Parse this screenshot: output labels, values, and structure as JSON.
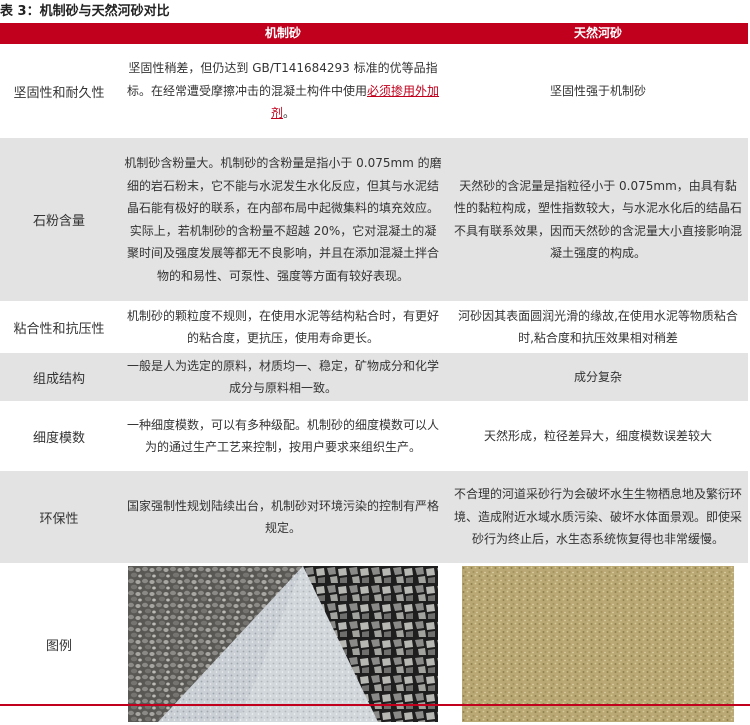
{
  "title": "表 3：机制砂与天然河砂对比",
  "header": {
    "col1": "",
    "col2": "机制砂",
    "col3": "天然河砂"
  },
  "rows": [
    {
      "label": "坚固性和耐久性",
      "manufactured_pre": "坚固性稍差，但仍达到 GB/T141684293 标准的优等品指标。在经常遭受摩擦冲击的混凝土构件中使用",
      "manufactured_highlight": "必须掺用外加剂",
      "manufactured_post": "。",
      "natural": "坚固性强于机制砂"
    },
    {
      "label": "石粉含量",
      "manufactured": "机制砂含粉量大。机制砂的含粉量是指小于 0.075mm 的磨细的岩石粉末，它不能与水泥发生水化反应，但其与水泥结晶石能有极好的联系，在内部布局中起微集料的填充效应。实际上，若机制砂的含粉量不超越 20%，它对混凝土的凝聚时间及强度发展等都无不良影响，并且在添加混凝土拌合物的和易性、可泵性、强度等方面有较好表现。",
      "natural": "天然砂的含泥量是指粒径小于 0.075mm，由具有黏性的黏粒构成，塑性指数较大，与水泥水化后的结晶石不具有联系效果，因而天然砂的含泥量大小直接影响混凝土强度的构成。"
    },
    {
      "label": "粘合性和抗压性",
      "manufactured": "机制砂的颗粒度不规则，在使用水泥等结构粘合时，有更好的粘合度，更抗压，使用寿命更长。",
      "natural": "河砂因其表面圆润光滑的缘故,在使用水泥等物质粘合时,粘合度和抗压效果相对稍差"
    },
    {
      "label": "组成结构",
      "manufactured": "一般是人为选定的原料，材质均一、稳定，矿物成分和化学成分与原料相一致。",
      "natural": "成分复杂"
    },
    {
      "label": "细度模数",
      "manufactured": "一种细度模数，可以有多种级配。机制砂的细度模数可以人为的通过生产工艺来控制，按用户要求来组织生产。",
      "natural": "天然形成，粒径差异大，细度模数误差较大"
    },
    {
      "label": "环保性",
      "manufactured": "国家强制性规划陆续出台，机制砂对环境污染的控制有严格规定。",
      "natural": "不合理的河道采砂行为会破坏水生生物栖息地及繁衍环境、造成附近水域水质污染、破坏水体面景观。即使采砂行为终止后，水生态系统恢复得也非常缓慢。"
    },
    {
      "label": "图例"
    }
  ],
  "colors": {
    "header_bg": "#c0001c",
    "alt_row_bg": "#e3e3e3",
    "highlight": "#c0001c"
  }
}
